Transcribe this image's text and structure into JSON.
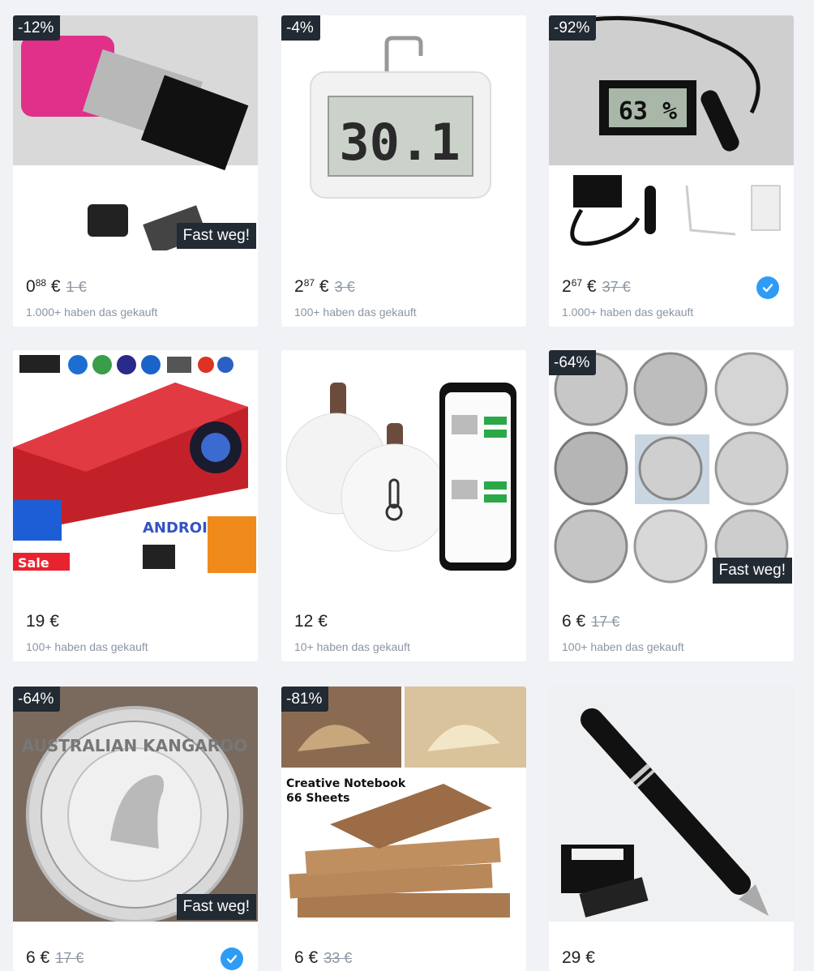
{
  "products": [
    {
      "discount": "-12%",
      "badge": "Fast weg!",
      "price_int": "0",
      "price_dec": "88",
      "currency": "€",
      "old_price": "1 €",
      "sold": "1.000+ haben das gekauft",
      "verified": false
    },
    {
      "discount": "-4%",
      "badge": "",
      "price_int": "2",
      "price_dec": "87",
      "currency": "€",
      "old_price": "3 €",
      "sold": "100+ haben das gekauft",
      "verified": false
    },
    {
      "discount": "-92%",
      "badge": "",
      "price_int": "2",
      "price_dec": "67",
      "currency": "€",
      "old_price": "37 €",
      "sold": "1.000+ haben das gekauft",
      "verified": true
    },
    {
      "discount": "",
      "badge": "",
      "price_int": "19",
      "price_dec": "",
      "currency": "€",
      "old_price": "",
      "sold": "100+ haben das gekauft",
      "verified": false
    },
    {
      "discount": "",
      "badge": "",
      "price_int": "12",
      "price_dec": "",
      "currency": "€",
      "old_price": "",
      "sold": "10+ haben das gekauft",
      "verified": false
    },
    {
      "discount": "-64%",
      "badge": "Fast weg!",
      "price_int": "6",
      "price_dec": "",
      "currency": "€",
      "old_price": "17 €",
      "sold": "100+ haben das gekauft",
      "verified": false
    },
    {
      "discount": "-64%",
      "badge": "Fast weg!",
      "price_int": "6",
      "price_dec": "",
      "currency": "€",
      "old_price": "17 €",
      "sold": "",
      "verified": true
    },
    {
      "discount": "-81%",
      "badge": "",
      "price_int": "6",
      "price_dec": "",
      "currency": "€",
      "old_price": "33 €",
      "sold": "",
      "verified": false
    },
    {
      "discount": "",
      "badge": "",
      "price_int": "29",
      "price_dec": "",
      "currency": "€",
      "old_price": "",
      "sold": "",
      "verified": false
    }
  ],
  "image_text": {
    "thermo_display": "30.1",
    "hygro_display": "63 %",
    "notebook_title": "Creative Notebook",
    "notebook_sub": "66 Sheets",
    "coin_text": "AUSTRALIAN KANGAROO",
    "projector_sale": "Sale",
    "projector_android": "ANDROID"
  },
  "colors": {
    "badge_bg": "#222a33",
    "verified": "#2e9cf5",
    "muted": "#8a96a3"
  }
}
